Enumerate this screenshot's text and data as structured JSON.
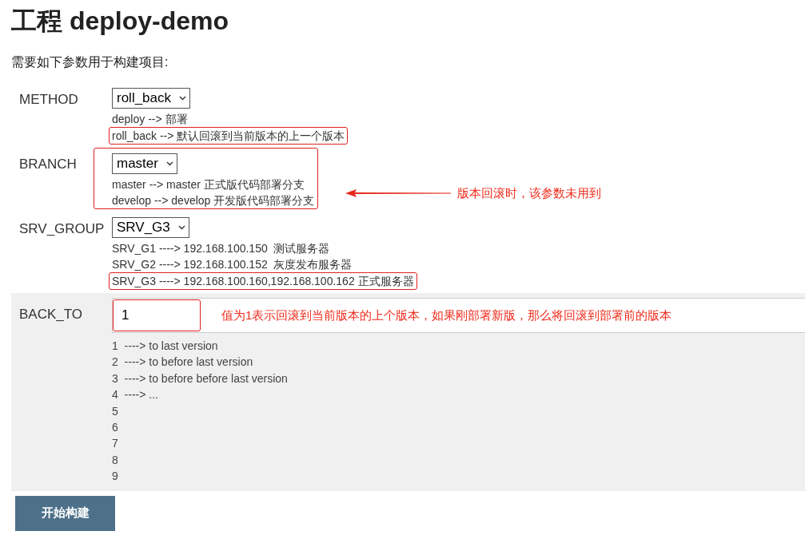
{
  "title": "工程 deploy-demo",
  "intro": "需要如下参数用于构建项目:",
  "params": [
    {
      "kind": "choice",
      "name": "METHOD",
      "value": "roll_back",
      "highlighted": false,
      "lines": [
        {
          "text": "deploy --> 部署",
          "highlighted": false
        },
        {
          "text": "roll_back --> 默认回滚到当前版本的上一个版本",
          "highlighted": true
        }
      ]
    },
    {
      "kind": "choice",
      "name": "BRANCH",
      "value": "master",
      "highlighted": true,
      "note": "版本回滚时，该参数未用到",
      "lines": [
        {
          "text": "master --> master 正式版代码部署分支",
          "highlighted": false
        },
        {
          "text": "develop --> develop 开发版代码部署分支",
          "highlighted": false
        }
      ]
    },
    {
      "kind": "choice",
      "name": "SRV_GROUP",
      "value": "SRV_G3",
      "highlighted": false,
      "lines": [
        {
          "text": "SRV_G1 ----> 192.168.100.150  测试服务器",
          "highlighted": false
        },
        {
          "text": "SRV_G2 ----> 192.168.100.152  灰度发布服务器",
          "highlighted": false
        },
        {
          "text": "SRV_G3 ----> 192.168.100.160,192.168.100.162 正式服务器",
          "highlighted": true
        }
      ]
    },
    {
      "kind": "text",
      "name": "BACK_TO",
      "value": "1",
      "highlighted": true,
      "note": "值为1表示回滚到当前版本的上个版本，如果刚部署新版，那么将回滚到部署前的版本",
      "lines": [
        {
          "text": "1  ----> to last version",
          "highlighted": false
        },
        {
          "text": "2  ----> to before last version",
          "highlighted": false
        },
        {
          "text": "3  ----> to before before last version",
          "highlighted": false
        },
        {
          "text": "4  ----> ...",
          "highlighted": false
        },
        {
          "text": "5",
          "highlighted": false
        },
        {
          "text": "6",
          "highlighted": false
        },
        {
          "text": "7",
          "highlighted": false
        },
        {
          "text": "8",
          "highlighted": false
        },
        {
          "text": "9",
          "highlighted": false
        }
      ]
    }
  ],
  "button": "开始构建"
}
